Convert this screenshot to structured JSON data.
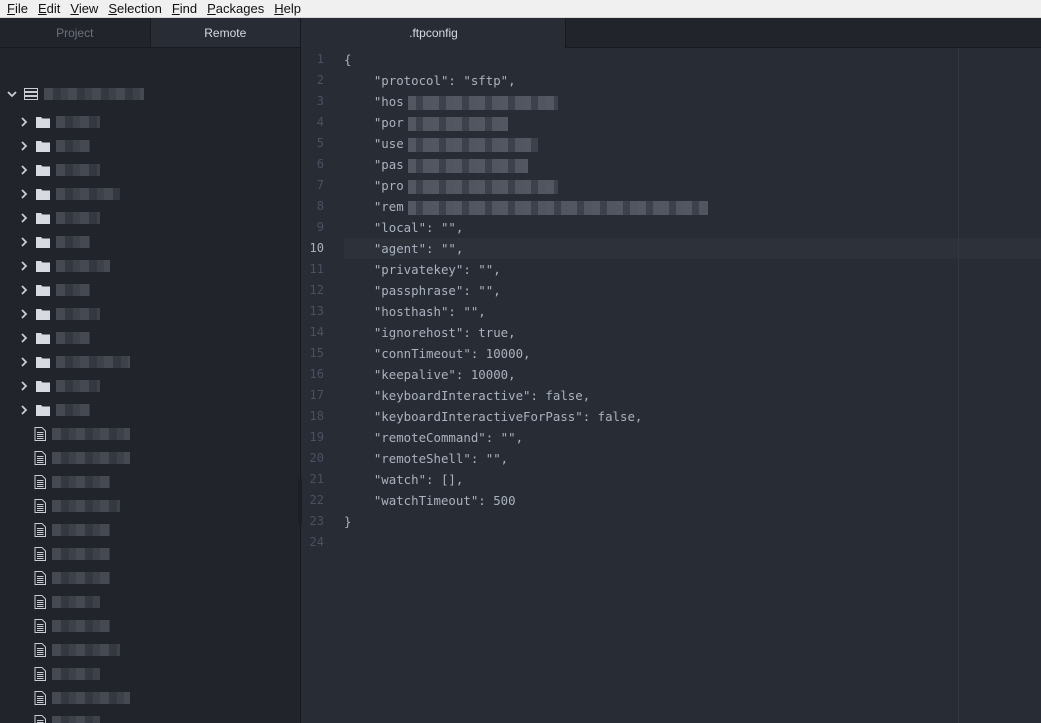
{
  "menubar": {
    "items": [
      {
        "label": "File",
        "mn": "F",
        "rest": "ile"
      },
      {
        "label": "Edit",
        "mn": "E",
        "rest": "dit"
      },
      {
        "label": "View",
        "mn": "V",
        "rest": "iew"
      },
      {
        "label": "Selection",
        "mn": "S",
        "rest": "election"
      },
      {
        "label": "Find",
        "mn": "F",
        "rest": "ind"
      },
      {
        "label": "Packages",
        "mn": "P",
        "rest": "ackages"
      },
      {
        "label": "Help",
        "mn": "H",
        "rest": "elp"
      }
    ]
  },
  "sidebar": {
    "tabs": [
      {
        "label": "Project",
        "active": false
      },
      {
        "label": "Remote",
        "active": true
      }
    ]
  },
  "editor": {
    "tab_title": ".ftpconfig",
    "current_line": 10,
    "line_numbers": [
      "1",
      "2",
      "3",
      "4",
      "5",
      "6",
      "7",
      "8",
      "9",
      "10",
      "11",
      "12",
      "13",
      "14",
      "15",
      "16",
      "17",
      "18",
      "19",
      "20",
      "21",
      "22",
      "23",
      "24"
    ],
    "lines": [
      {
        "text": "{"
      },
      {
        "text": "    \"protocol\": \"sftp\","
      },
      {
        "text": "    \"hos"
      },
      {
        "text": "    \"por"
      },
      {
        "text": "    \"use"
      },
      {
        "text": "    \"pas"
      },
      {
        "text": "    \"pro"
      },
      {
        "text": "    \"rem"
      },
      {
        "text": "    \"local\": \"\","
      },
      {
        "text": "    \"agent\": \"\","
      },
      {
        "text": "    \"privatekey\": \"\","
      },
      {
        "text": "    \"passphrase\": \"\","
      },
      {
        "text": "    \"hosthash\": \"\","
      },
      {
        "text": "    \"ignorehost\": true,"
      },
      {
        "text": "    \"connTimeout\": 10000,"
      },
      {
        "text": "    \"keepalive\": 10000,"
      },
      {
        "text": "    \"keyboardInteractive\": false,"
      },
      {
        "text": "    \"keyboardInteractiveForPass\": false,"
      },
      {
        "text": "    \"remoteCommand\": \"\","
      },
      {
        "text": "    \"remoteShell\": \"\","
      },
      {
        "text": "    \"watch\": [],"
      },
      {
        "text": "    \"watchTimeout\": 500"
      },
      {
        "text": "}"
      },
      {
        "text": ""
      }
    ]
  },
  "icons": {
    "menu": "none",
    "tree_chevron": "chevron-right-icon",
    "folder": "folder-icon",
    "file": "file-text-icon",
    "server": "server-icon",
    "collapse": "chevron-left-icon"
  }
}
